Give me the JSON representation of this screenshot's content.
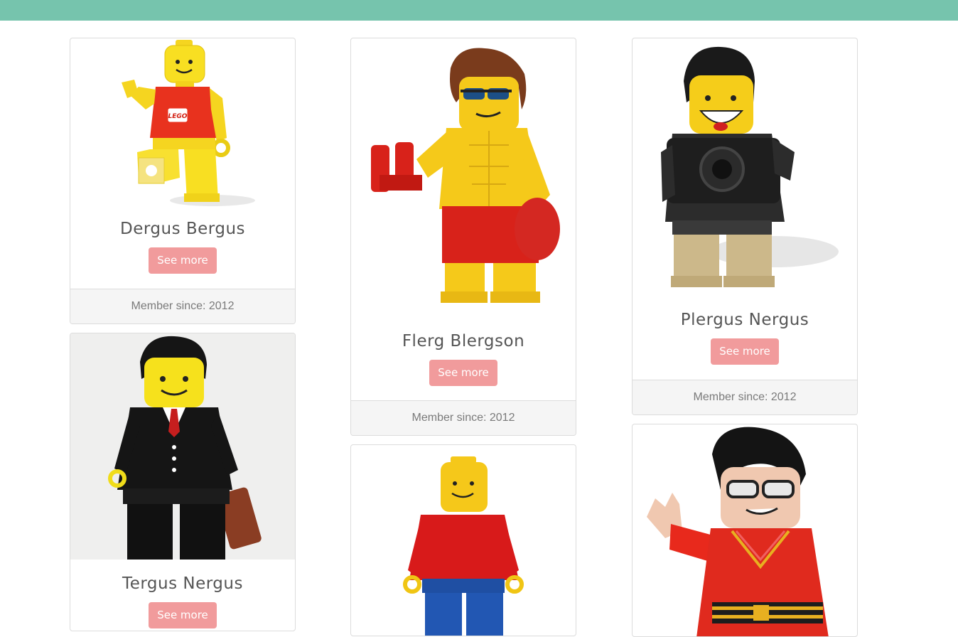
{
  "header": {
    "bar_color": "#76c4ad"
  },
  "members": [
    {
      "name": "Dergus Bergus",
      "button_label": "See more",
      "member_since": "Member since: 2012",
      "image": "lego-minifig-classic-waving-icon",
      "logo_text": "LEGO"
    },
    {
      "name": "Flerg Blergson",
      "button_label": "See more",
      "member_since": "Member since: 2012",
      "image": "lego-minifig-lifeguard-icon"
    },
    {
      "name": "Plergus Nergus",
      "button_label": "See more",
      "member_since": "Member since: 2012",
      "image": "lego-minifig-photographer-icon"
    },
    {
      "name": "Tergus Nergus",
      "button_label": "See more",
      "image": "lego-minifig-businessman-icon"
    },
    {
      "image": "lego-minifig-classic-red-icon"
    },
    {
      "image": "lego-minifig-retro-hero-icon"
    }
  ],
  "colors": {
    "button": "#f19b9c",
    "footer_bg": "#f5f5f5",
    "text": "#555555"
  }
}
